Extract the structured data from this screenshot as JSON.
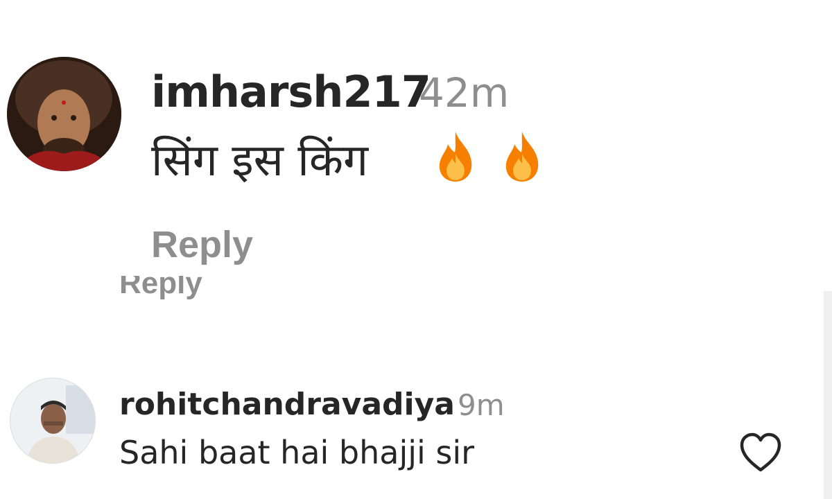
{
  "comments": [
    {
      "username": "imharsh217",
      "time": "42m",
      "text": "सिंग इस किंग",
      "emojis": [
        "fire-icon",
        "fire-icon"
      ],
      "reply_label": "Reply"
    },
    {
      "username": "rohitchandravadiya",
      "time": "9m",
      "text": "Sahi baat hai bhajji sir",
      "like_icon": "heart-icon"
    }
  ],
  "partial_reply_label": "Reply",
  "colors": {
    "primary_text": "#262626",
    "secondary_text": "#8e8e8e",
    "fire_outer": "#f77f00",
    "fire_inner": "#fcbf49"
  }
}
